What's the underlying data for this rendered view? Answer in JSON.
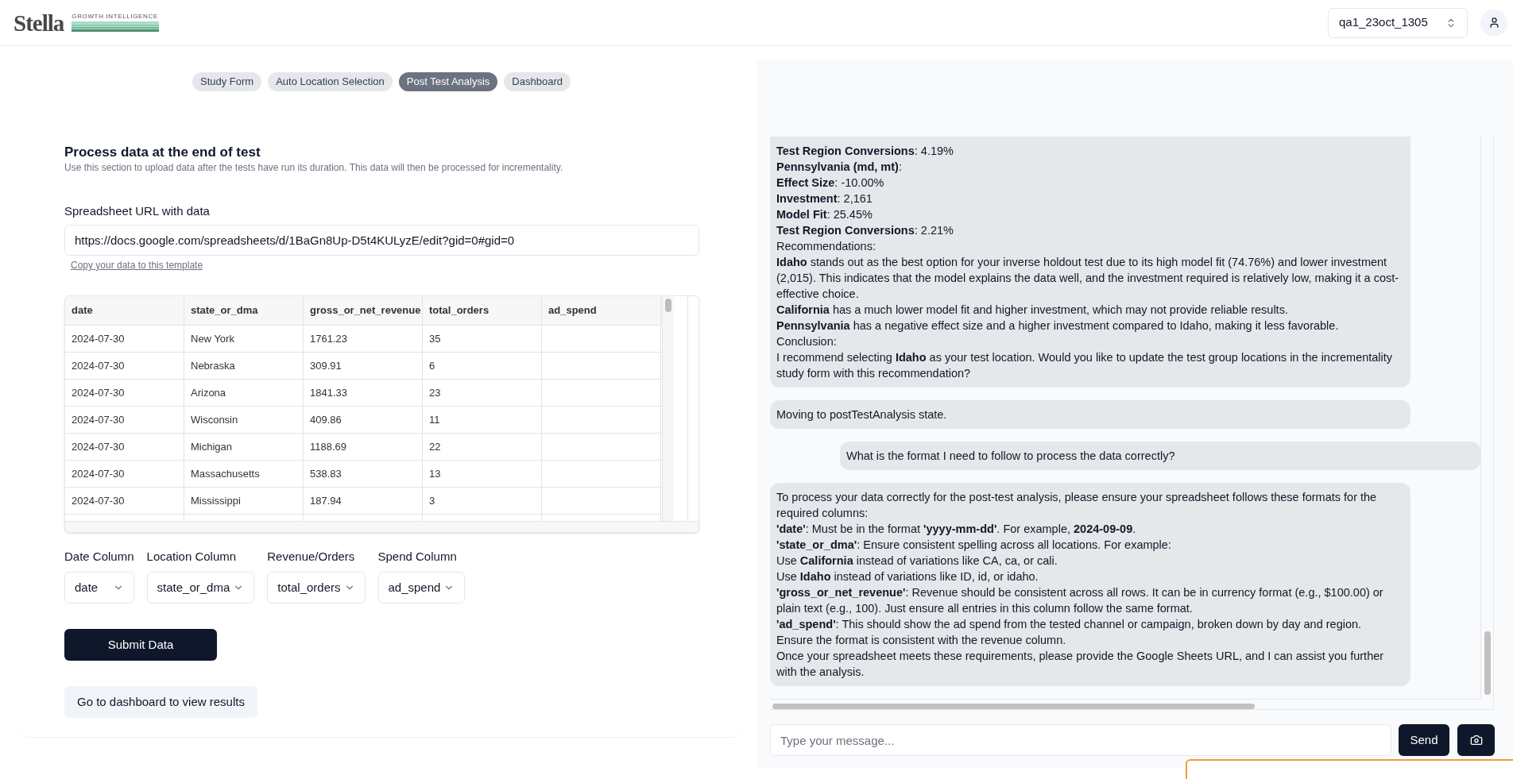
{
  "header": {
    "logo_wordmark": "Stella",
    "logo_tagline": "GROWTH INTELLIGENCE",
    "account_select": {
      "value": "qa1_23oct_1305"
    }
  },
  "tabs": [
    {
      "label": "Study Form",
      "selected": false
    },
    {
      "label": "Auto Location Selection",
      "selected": false
    },
    {
      "label": "Post Test Analysis",
      "selected": true
    },
    {
      "label": "Dashboard",
      "selected": false
    }
  ],
  "process_section": {
    "title": "Process data at the end of test",
    "description": "Use this section to upload data after the tests have run its duration. This data will then be processed for incrementality.",
    "url_field": {
      "label": "Spreadsheet URL with data",
      "value": "https://docs.google.com/spreadsheets/d/1BaGn8Up-D5t4KULyzE/edit?gid=0#gid=0"
    },
    "template_link": "Copy your data to this template",
    "table": {
      "columns": [
        "date",
        "state_or_dma",
        "gross_or_net_revenue",
        "total_orders",
        "ad_spend"
      ],
      "rows": [
        [
          "2024-07-30",
          "New York",
          "1761.23",
          "35"
        ],
        [
          "2024-07-30",
          "Nebraska",
          "309.91",
          "6"
        ],
        [
          "2024-07-30",
          "Arizona",
          "1841.33",
          "23"
        ],
        [
          "2024-07-30",
          "Wisconsin",
          "409.86",
          "11"
        ],
        [
          "2024-07-30",
          "Michigan",
          "1188.69",
          "22"
        ],
        [
          "2024-07-30",
          "Massachusetts",
          "538.83",
          "13"
        ],
        [
          "2024-07-30",
          "Mississippi",
          "187.94",
          "3"
        ]
      ]
    },
    "column_selects": [
      {
        "label": "Date Column",
        "value": "date"
      },
      {
        "label": "Location Column",
        "value": "state_or_dma"
      },
      {
        "label": "Revenue/Orders",
        "value": "total_orders"
      },
      {
        "label": "Spend Column",
        "value": "ad_spend"
      }
    ],
    "submit_button": "Submit Data",
    "dashboard_button": "Go to dashboard to view results"
  },
  "chat": {
    "messages": [
      {
        "kind": "assistant",
        "lines": [
          "**Test Region Conversions**: 4.19%",
          "**Pennsylvania (md, mt)**:",
          "**Effect Size**: -10.00%",
          "**Investment**: 2,161",
          "**Model Fit**: 25.45%",
          "**Test Region Conversions**: 2.21%",
          "Recommendations:",
          "**Idaho** stands out as the best option for your inverse holdout test due to its high model fit (74.76%) and lower investment (2,015). This indicates that the model explains the data well, and the investment required is relatively low, making it a cost-effective choice.",
          "**California** has a much lower model fit and higher investment, which may not provide reliable results.",
          "**Pennsylvania** has a negative effect size and a higher investment compared to Idaho, making it less favorable.",
          "Conclusion:",
          "I recommend selecting **Idaho** as your test location. Would you like to update the test group locations in the incrementality study form with this recommendation?"
        ]
      },
      {
        "kind": "assistant",
        "lines": [
          "Moving to postTestAnalysis state."
        ]
      },
      {
        "kind": "user",
        "lines": [
          "What is the format I need to follow to process the data correctly?"
        ]
      },
      {
        "kind": "assistant",
        "lines": [
          "To process your data correctly for the post-test analysis, please ensure your spreadsheet follows these formats for the required columns:",
          "**'date'**: Must be in the format **'yyyy-mm-dd'**. For example, **2024-09-09**.",
          "**'state_or_dma'**: Ensure consistent spelling across all locations. For example:",
          "Use **California** instead of variations like CA, ca, or cali.",
          "Use **Idaho** instead of variations like ID, id, or idaho.",
          "**'gross_or_net_revenue'**: Revenue should be consistent across all rows. It can be in currency format (e.g., $100.00) or plain text (e.g., 100). Just ensure all entries in this column follow the same format.",
          "**'ad_spend'**: This should show the ad spend from the tested channel or campaign, broken down by day and region.",
          "Ensure the format is consistent with the revenue column.",
          "Once your spreadsheet meets these requirements, please provide the Google Sheets URL, and I can assist you further with the analysis."
        ]
      }
    ],
    "input": {
      "placeholder": "Type your message..."
    },
    "send_button": "Send"
  }
}
